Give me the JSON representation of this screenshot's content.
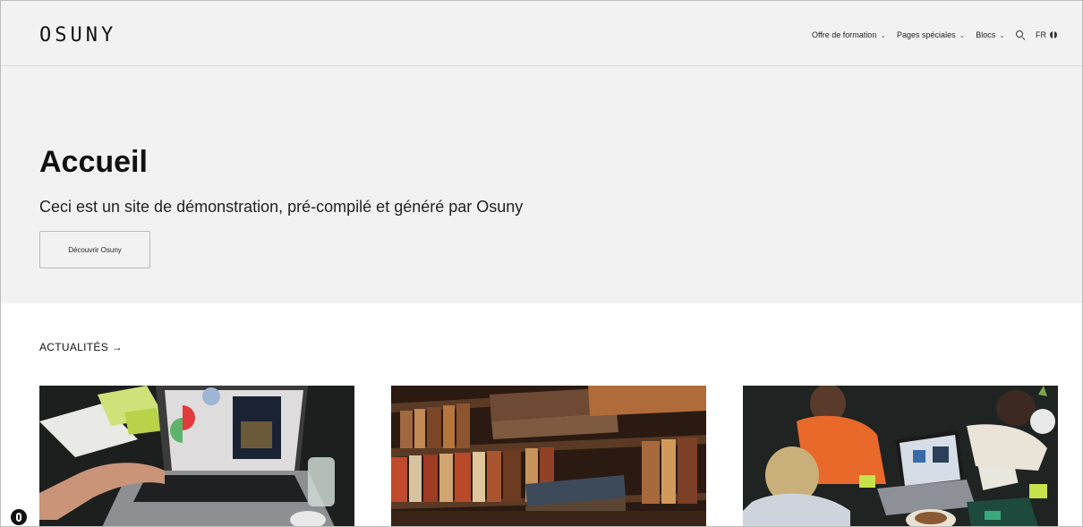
{
  "header": {
    "logo": "OSUNY",
    "nav": [
      {
        "label": "Offre de formation",
        "has_dropdown": true
      },
      {
        "label": "Pages spéciales",
        "has_dropdown": true
      },
      {
        "label": "Blocs",
        "has_dropdown": true
      }
    ],
    "search_icon": "search-icon",
    "language": "FR",
    "language_icon": "globe-icon"
  },
  "hero": {
    "title": "Accueil",
    "subtitle": "Ceci est un site de démonstration, pré-compilé et généré par Osuny",
    "button_label": "Découvrir Osuny"
  },
  "news": {
    "heading": "ACTUALITÉS →",
    "cards": [
      {
        "image": "laptop-workspace-photo"
      },
      {
        "image": "library-books-photo"
      },
      {
        "image": "team-meeting-photo"
      }
    ]
  },
  "colors": {
    "background": "#f2f2f2",
    "text": "#111111",
    "page": "#ffffff"
  }
}
